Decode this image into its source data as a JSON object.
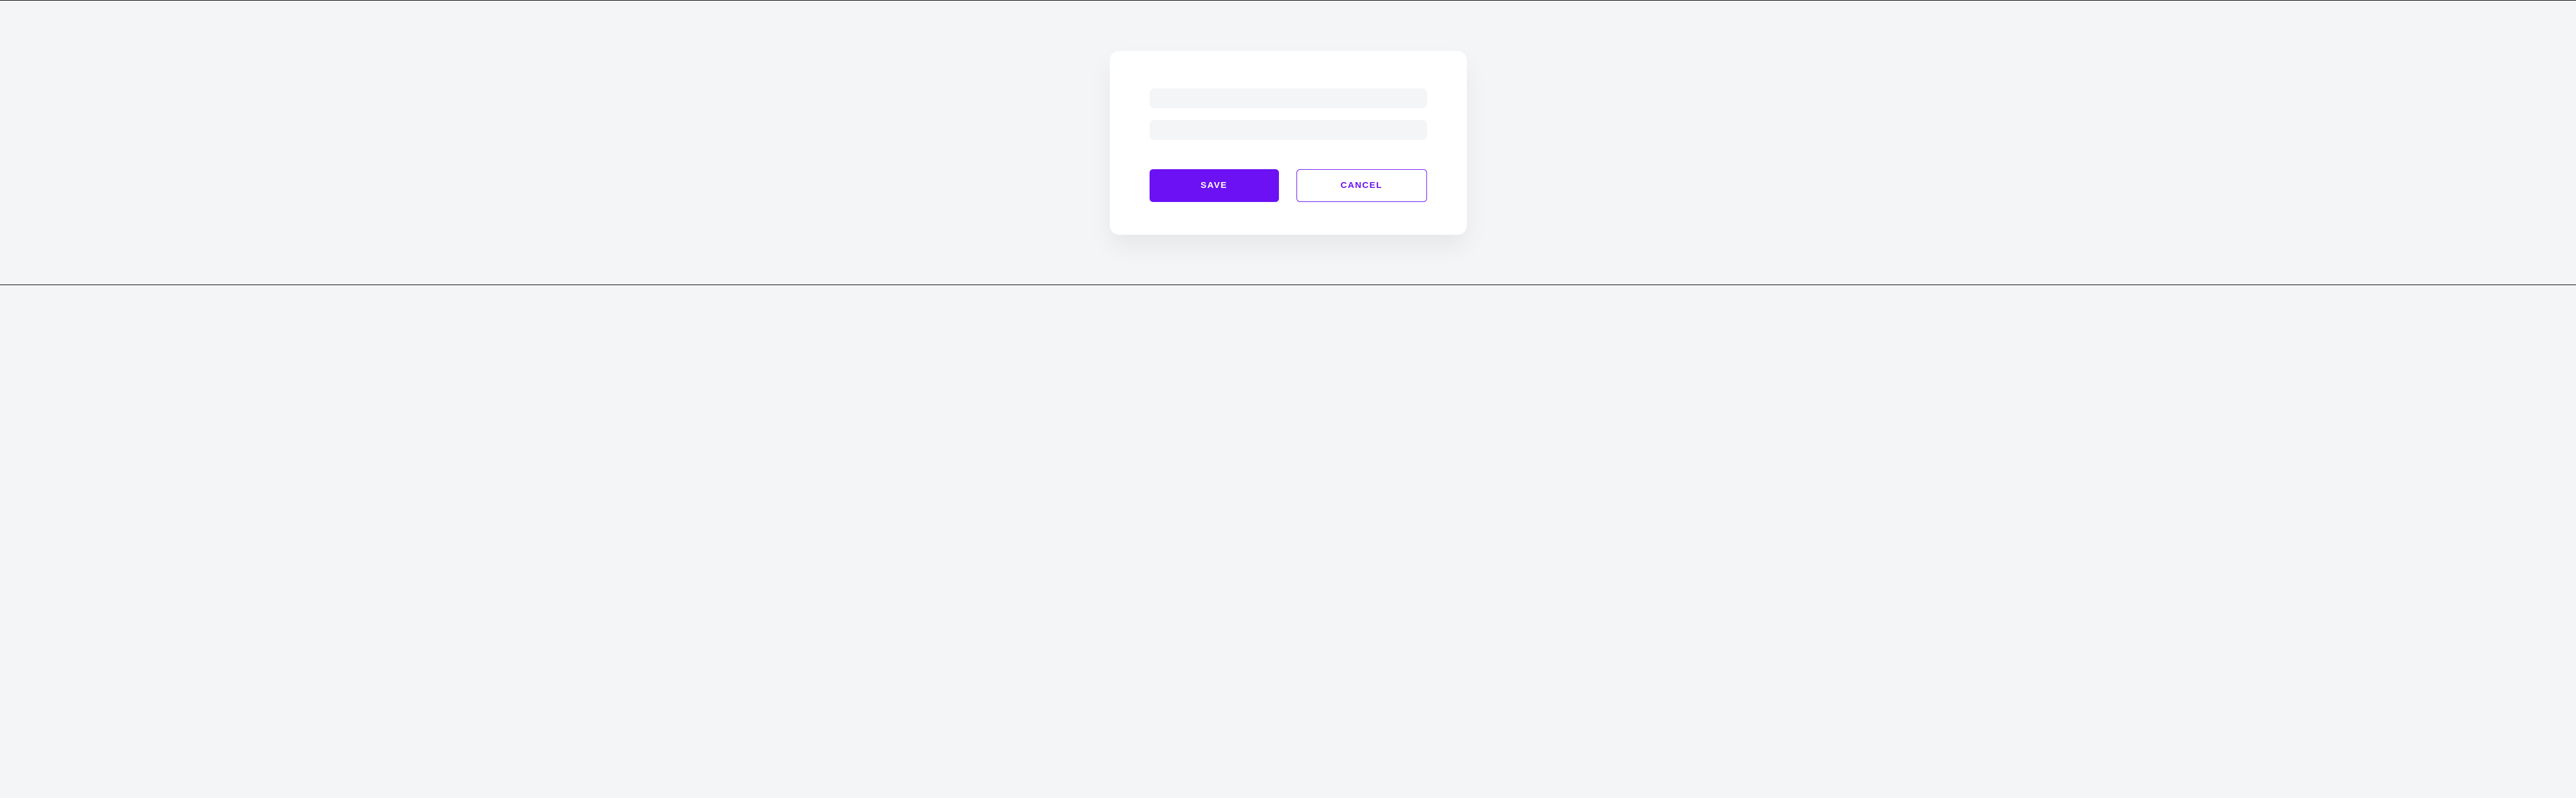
{
  "form": {
    "fields": [
      {
        "value": "",
        "placeholder": ""
      },
      {
        "value": "",
        "placeholder": ""
      }
    ],
    "buttons": {
      "save_label": "Save",
      "cancel_label": "Cancel"
    }
  },
  "colors": {
    "accent": "#6b11f4",
    "background": "#f4f5f7",
    "card": "#ffffff"
  }
}
